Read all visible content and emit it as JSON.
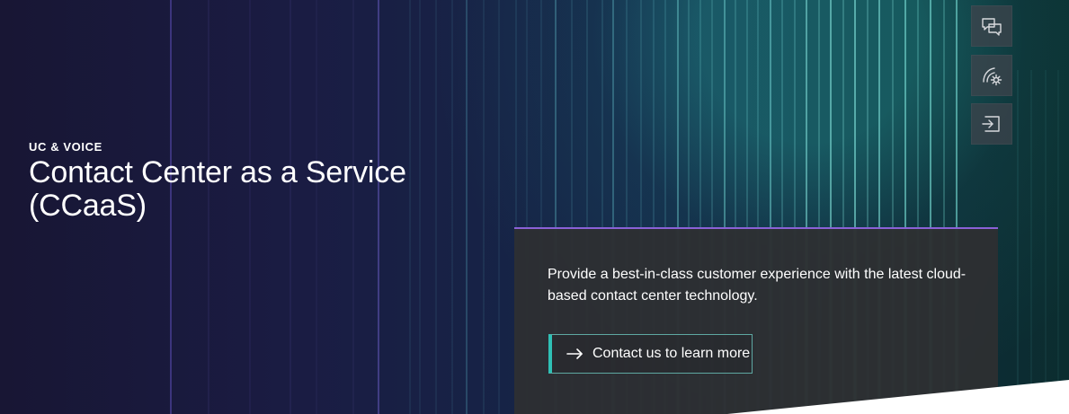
{
  "hero": {
    "eyebrow": "UC & VOICE",
    "title_line_1": "Contact Center as a Service",
    "title_line_2": "(CCaaS)",
    "description_line_1": "Provide a best-in-class customer experience with the latest cloud-",
    "description_line_2": "based contact center technology.",
    "cta_label": "Contact us to learn more"
  },
  "icons": {
    "chat": "chat-bubbles-icon",
    "support": "signal-sun-icon",
    "forward": "forward-box-icon",
    "cta": "arrow-right-icon"
  },
  "colors": {
    "background_start": "#181634",
    "background_end": "#0b2d2f",
    "accent_teal": "#2fc0b5",
    "accent_purple": "#8a61d7",
    "panel": "#2e2f31"
  }
}
